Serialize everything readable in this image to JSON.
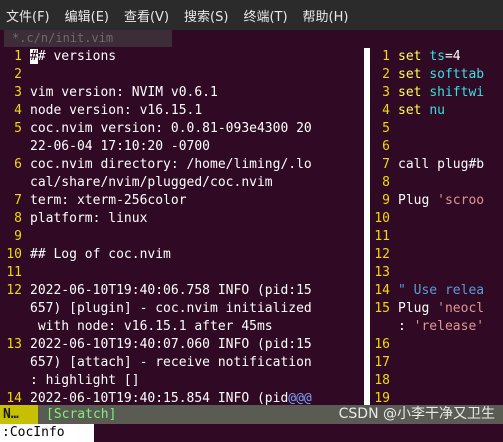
{
  "menu": [
    "文件(F)",
    "编辑(E)",
    "查看(V)",
    "搜索(S)",
    "终端(T)",
    "帮助(H)"
  ],
  "tab_old_label": "*.c/n/init.vim",
  "left_lines": [
    {
      "n": "1",
      "segments": [
        {
          "t": "#",
          "c": "cur"
        },
        {
          "t": "# versions",
          "c": ""
        }
      ]
    },
    {
      "n": "2",
      "segments": []
    },
    {
      "n": "3",
      "segments": [
        {
          "t": "vim version: NVIM v0.6.1",
          "c": ""
        }
      ]
    },
    {
      "n": "4",
      "segments": [
        {
          "t": "node version: v16.15.1",
          "c": ""
        }
      ]
    },
    {
      "n": "5",
      "segments": [
        {
          "t": "coc.nvim version: 0.0.81-093e4300 20",
          "c": ""
        }
      ]
    },
    {
      "n": "",
      "segments": [
        {
          "t": "22-06-04 17:10:20 -0700",
          "c": ""
        }
      ]
    },
    {
      "n": "6",
      "segments": [
        {
          "t": "coc.nvim directory: /home/liming/.lo",
          "c": ""
        }
      ]
    },
    {
      "n": "",
      "segments": [
        {
          "t": "cal/share/nvim/plugged/coc.nvim",
          "c": ""
        }
      ]
    },
    {
      "n": "7",
      "segments": [
        {
          "t": "term: xterm-256color",
          "c": ""
        }
      ]
    },
    {
      "n": "8",
      "segments": [
        {
          "t": "platform: linux",
          "c": ""
        }
      ]
    },
    {
      "n": "9",
      "segments": []
    },
    {
      "n": "10",
      "segments": [
        {
          "t": "## Log of coc.nvim",
          "c": ""
        }
      ]
    },
    {
      "n": "11",
      "segments": []
    },
    {
      "n": "12",
      "segments": [
        {
          "t": "2022-06-10T19:40:06.758 INFO (pid:15",
          "c": ""
        }
      ]
    },
    {
      "n": "",
      "segments": [
        {
          "t": "657) [plugin] - coc.nvim initialized",
          "c": ""
        }
      ]
    },
    {
      "n": "",
      "segments": [
        {
          "t": " with node: v16.15.1 after 45ms",
          "c": ""
        }
      ]
    },
    {
      "n": "13",
      "segments": [
        {
          "t": "2022-06-10T19:40:07.060 INFO (pid:15",
          "c": ""
        }
      ]
    },
    {
      "n": "",
      "segments": [
        {
          "t": "657) [attach] - receive notification",
          "c": ""
        }
      ]
    },
    {
      "n": "",
      "segments": [
        {
          "t": ": highlight []",
          "c": ""
        }
      ]
    },
    {
      "n": "14",
      "segments": [
        {
          "t": "2022-06-10T19:40:15.854 INFO (pid",
          "c": ""
        },
        {
          "t": "@@@",
          "c": "at"
        }
      ]
    }
  ],
  "right_lines": [
    {
      "n": "1",
      "segments": [
        {
          "t": "set ",
          "c": "kw"
        },
        {
          "t": "ts",
          "c": "id"
        },
        {
          "t": "=4",
          "c": ""
        }
      ]
    },
    {
      "n": "2",
      "segments": [
        {
          "t": "set ",
          "c": "kw"
        },
        {
          "t": "softtab",
          "c": "id"
        }
      ]
    },
    {
      "n": "3",
      "segments": [
        {
          "t": "set ",
          "c": "kw"
        },
        {
          "t": "shiftwi",
          "c": "id"
        }
      ]
    },
    {
      "n": "4",
      "segments": [
        {
          "t": "set ",
          "c": "kw"
        },
        {
          "t": "nu",
          "c": "id"
        }
      ]
    },
    {
      "n": "5",
      "segments": []
    },
    {
      "n": "6",
      "segments": []
    },
    {
      "n": "7",
      "segments": [
        {
          "t": "call plug#b",
          "c": ""
        }
      ]
    },
    {
      "n": "8",
      "segments": []
    },
    {
      "n": "9",
      "segments": [
        {
          "t": "Plug ",
          "c": ""
        },
        {
          "t": "'scroo",
          "c": "str"
        }
      ]
    },
    {
      "n": "10",
      "segments": []
    },
    {
      "n": "11",
      "segments": []
    },
    {
      "n": "12",
      "segments": []
    },
    {
      "n": "13",
      "segments": []
    },
    {
      "n": "14",
      "segments": [
        {
          "t": "\" Use relea",
          "c": "cmt"
        }
      ]
    },
    {
      "n": "15",
      "segments": [
        {
          "t": "Plug ",
          "c": ""
        },
        {
          "t": "'neocl",
          "c": "str"
        }
      ]
    },
    {
      "n": "",
      "segments": [
        {
          "t": ": ",
          "c": ""
        },
        {
          "t": "'release'",
          "c": "str"
        }
      ]
    },
    {
      "n": "16",
      "segments": []
    },
    {
      "n": "17",
      "segments": []
    },
    {
      "n": "18",
      "segments": []
    },
    {
      "n": "19",
      "segments": []
    }
  ],
  "status": {
    "mode": "N…",
    "buffer": "[Scratch]",
    "watermark": "CSDN @小李干净又卫生"
  },
  "cmdline": ":CocInfo"
}
